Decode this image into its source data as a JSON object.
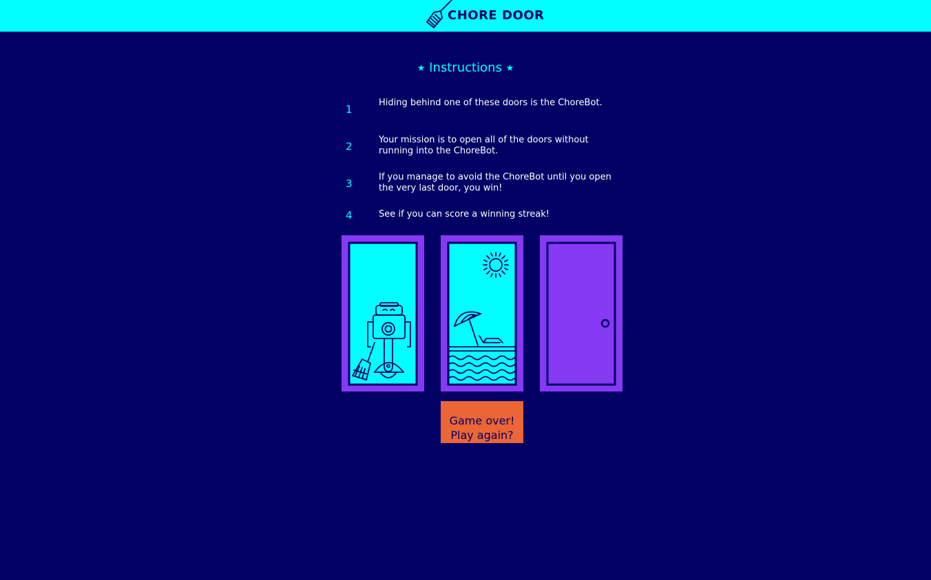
{
  "header": {
    "title": "CHORE DOOR",
    "logo_icon": "broom-icon"
  },
  "instructions": {
    "title": "Instructions",
    "star_glyph": "★",
    "items": [
      {
        "number": "1",
        "text": "Hiding behind one of these doors is the ChoreBot."
      },
      {
        "number": "2",
        "text": "Your mission is to open all of the doors without running into the ChoreBot."
      },
      {
        "number": "3",
        "text": "If you manage to avoid the ChoreBot until you open the very last door, you win!"
      },
      {
        "number": "4",
        "text": "See if you can score a winning streak!"
      }
    ]
  },
  "doors": [
    {
      "state": "open",
      "reveals": "robot-icon"
    },
    {
      "state": "open",
      "reveals": "beach-icon"
    },
    {
      "state": "closed",
      "reveals": "closed-door-icon"
    }
  ],
  "play_button": {
    "line1": "Game over!",
    "line2": "Play again?"
  },
  "colors": {
    "background": "#010165",
    "accent": "#00ffff",
    "door_frame": "#8639f2",
    "button": "#eb6536",
    "text": "#ffffff"
  }
}
